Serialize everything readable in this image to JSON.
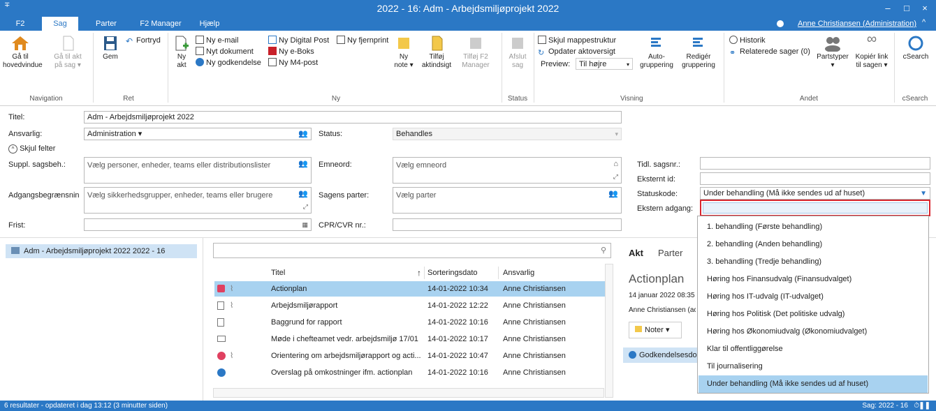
{
  "window": {
    "title": "2022 - 16: Adm - Arbejdsmiljøprojekt 2022",
    "quick_access": "∓",
    "minimize": "–",
    "maximize": "□",
    "close": "×"
  },
  "tabs": [
    "F2",
    "Sag",
    "Parter",
    "F2 Manager",
    "Hjælp"
  ],
  "active_tab": "Sag",
  "user": "Anne Christiansen (Administration)",
  "ribbon": {
    "navigation": {
      "group": "Navigation",
      "goto_main": [
        "Gå til",
        "hovedvindue"
      ],
      "goto_act": [
        "Gå til akt",
        "på sag ▾"
      ]
    },
    "ret": {
      "group": "Ret",
      "save": "Gem",
      "undo": "Fortryd"
    },
    "ny": {
      "group": "Ny",
      "new_act": [
        "Ny",
        "akt"
      ],
      "new_email": "Ny e-mail",
      "new_document": "Nyt dokument",
      "new_approval": "Ny godkendelse",
      "new_digital_post": "Ny Digital Post",
      "new_eboks": "Ny e-Boks",
      "new_m4": "Ny M4-post",
      "new_remote_print": "Ny fjernprint"
    },
    "misc": {
      "new_note": [
        "Ny",
        "note ▾"
      ],
      "add_aktindsigt": [
        "Tilføj",
        "aktindsigt"
      ],
      "add_f2_manager": [
        "Tilføj F2",
        "Manager"
      ]
    },
    "status": {
      "group": "Status",
      "close_case": [
        "Afslut",
        "sag"
      ]
    },
    "visning": {
      "group": "Visning",
      "hide_folder_structure": "Skjul mappestruktur",
      "update_act_overview": "Opdater aktoversigt",
      "preview_label": "Preview:",
      "preview_value": "Til højre",
      "auto_grouping": [
        "Auto-",
        "gruppering"
      ],
      "edit_grouping": [
        "Redigér",
        "gruppering"
      ]
    },
    "andet": {
      "group": "Andet",
      "history": "Historik",
      "related_cases": "Relaterede sager (0)",
      "party_types": [
        "Partstyper",
        "▾"
      ],
      "copy_link": [
        "Kopiér link",
        "til sagen ▾"
      ]
    },
    "csearch": {
      "group": "cSearch",
      "label": "cSearch"
    }
  },
  "form": {
    "title_label": "Titel:",
    "title_value": "Adm - Arbejdsmiljøprojekt 2022",
    "responsible_label": "Ansvarlig:",
    "responsible_value": "Administration ▾",
    "status_label": "Status:",
    "status_value": "Behandles",
    "hide_fields": "Skjul felter",
    "suppl_label": "Suppl. sagsbeh.:",
    "suppl_placeholder": "Vælg personer, enheder, teams eller distributionslister",
    "subject_label": "Emneord:",
    "subject_placeholder": "Vælg emneord",
    "access_label": "Adgangsbegrænsnin",
    "access_placeholder": "Vælg sikkerhedsgrupper, enheder, teams eller brugere",
    "parties_label": "Sagens parter:",
    "parties_placeholder": "Vælg parter",
    "deadline_label": "Frist:",
    "cpr_label": "CPR/CVR nr.:",
    "prev_case_label": "Tidl. sagsnr.:",
    "external_id_label": "Eksternt id:",
    "status_code_label": "Statuskode:",
    "status_code_value": "Under behandling (Må ikke sendes ud af huset)",
    "external_access_label": "Ekstern adgang:"
  },
  "tree": {
    "item": "Adm - Arbejdsmiljøprojekt 2022 2022 - 16"
  },
  "table": {
    "columns": [
      "Titel",
      "Sorteringsdato",
      "Ansvarlig"
    ],
    "rows": [
      {
        "title": "Actionplan",
        "date": "14-01-2022 10:34",
        "owner": "Anne Christiansen"
      },
      {
        "title": "Arbejdsmiljørapport",
        "date": "14-01-2022 12:22",
        "owner": "Anne Christiansen"
      },
      {
        "title": "Baggrund for rapport",
        "date": "14-01-2022 10:16",
        "owner": "Anne Christiansen"
      },
      {
        "title": "Møde i chefteamet vedr. arbejdsmiljø 17/01",
        "date": "14-01-2022 10:17",
        "owner": "Anne Christiansen"
      },
      {
        "title": "Orientering om arbejdsmiljørapport og acti...",
        "date": "14-01-2022 10:47",
        "owner": "Anne Christiansen"
      },
      {
        "title": "Overslag på omkostninger ifm. actionplan",
        "date": "14-01-2022 10:16",
        "owner": "Anne Christiansen"
      }
    ]
  },
  "preview": {
    "tab_akt": "Akt",
    "tab_parter": "Parter",
    "title": "Actionplan",
    "date_line": "14 januar 2022 08:35 (",
    "owner_line": "Anne Christiansen (ac",
    "notes_button": "Noter ▾",
    "approval": "Godkendelsesdoku"
  },
  "dropdown": {
    "options": [
      "1. behandling (Første behandling)",
      "2. behandling (Anden behandling)",
      "3. behandling (Tredje behandling)",
      "Høring hos Finansudvalg (Finansudvalget)",
      "Høring hos IT-udvalg (IT-udvalget)",
      "Høring hos Politisk (Det politiske udvalg)",
      "Høring hos Økonomiudvalg (Økonomiudvalget)",
      "Klar til offentliggørelse",
      "Til journalisering",
      "Under behandling (Må ikke sendes ud af huset)"
    ],
    "selected_index": 9
  },
  "statusbar": {
    "left": "6 resultater - opdateret i dag 13:12 (3 minutter siden)",
    "right": "Sag: 2022 - 16"
  },
  "colors": {
    "accent": "#2b78c5",
    "selection": "#a8d2f0",
    "highlight_border": "#d9262f"
  }
}
